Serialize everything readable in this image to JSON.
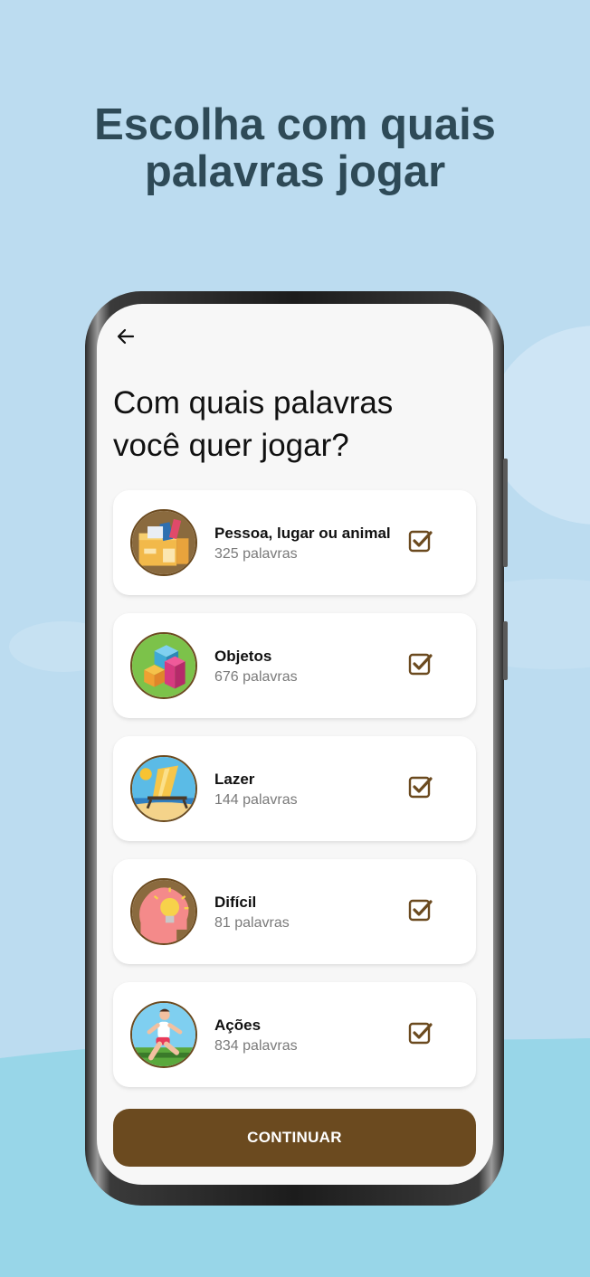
{
  "headline": {
    "line1": "Escolha com quais",
    "line2": "palavras jogar"
  },
  "screen": {
    "back_icon": "arrow-left-icon",
    "question_line1": "Com quais palavras",
    "question_line2": "você quer jogar?",
    "categories": [
      {
        "title": "Pessoa, lugar ou animal",
        "count": "325 palavras",
        "checked": true,
        "icon": "boxes-icon"
      },
      {
        "title": "Objetos",
        "count": "676 palavras",
        "checked": true,
        "icon": "cubes-icon"
      },
      {
        "title": "Lazer",
        "count": "144 palavras",
        "checked": true,
        "icon": "beach-chair-icon"
      },
      {
        "title": "Difícil",
        "count": "81 palavras",
        "checked": true,
        "icon": "lightbulb-head-icon"
      },
      {
        "title": "Ações",
        "count": "834 palavras",
        "checked": true,
        "icon": "runner-icon"
      }
    ],
    "continue_label": "CONTINUAR"
  },
  "colors": {
    "background_sky": "#bcdcf0",
    "background_bottom": "#98d6e8",
    "headline": "#2e4a57",
    "accent_brown": "#6b4a1f",
    "card": "#ffffff",
    "screen": "#f7f7f7"
  }
}
